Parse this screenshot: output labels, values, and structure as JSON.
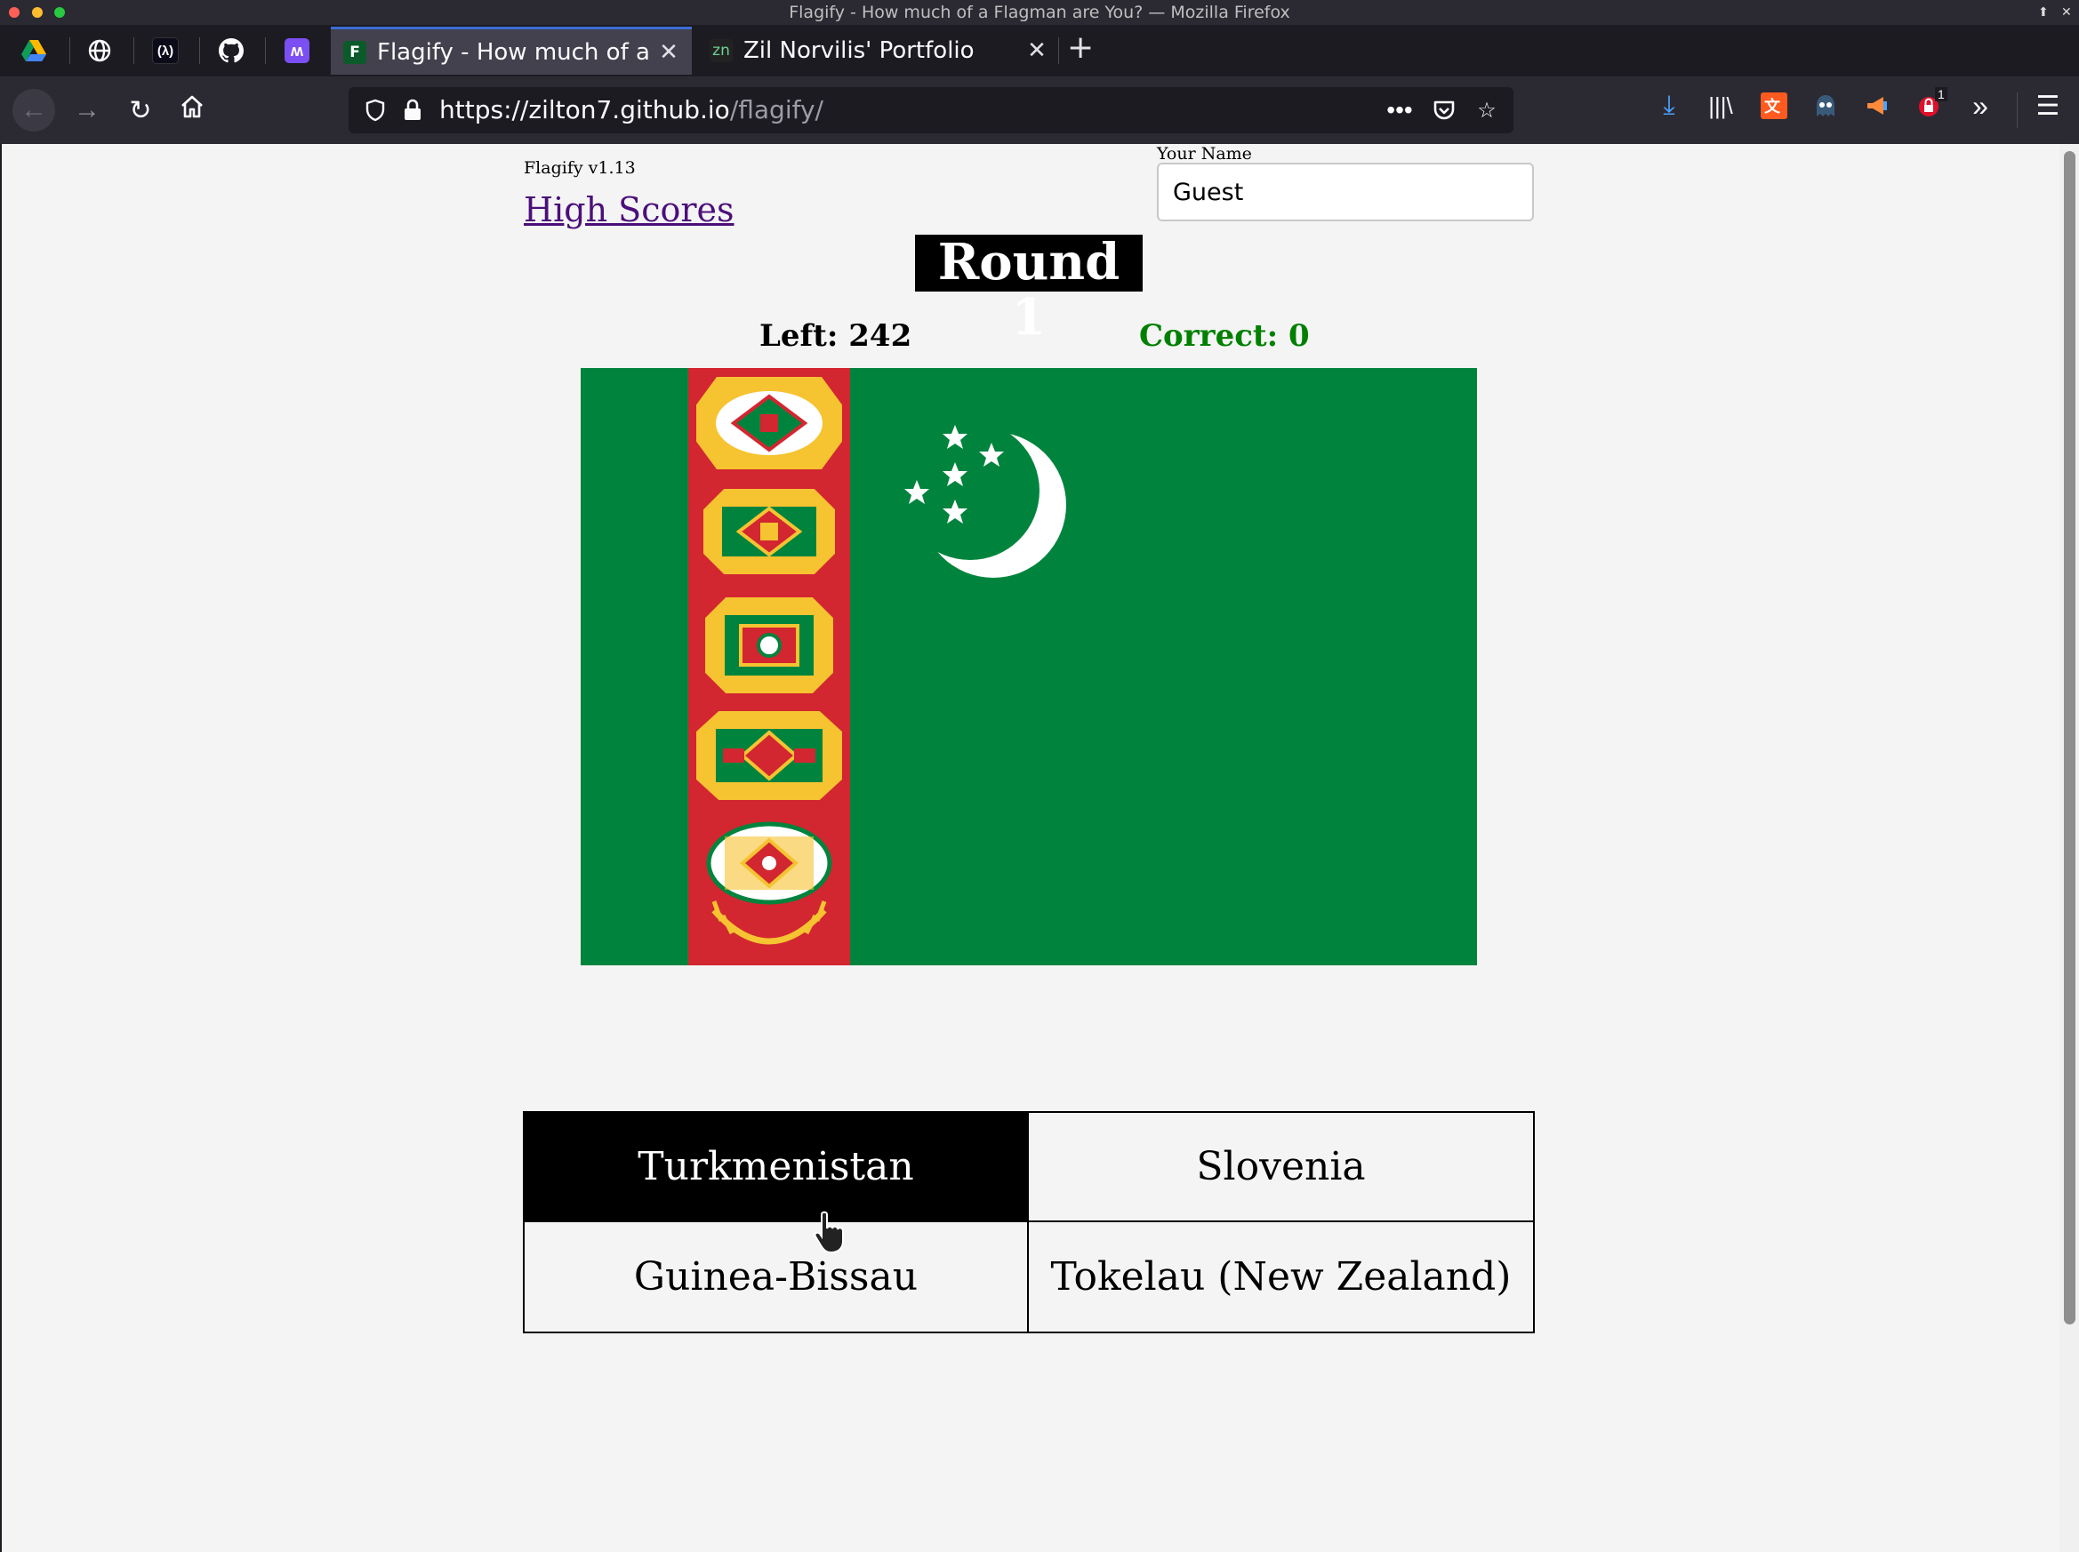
{
  "window": {
    "title": "Flagify - How much of a Flagman are You? — Mozilla Firefox"
  },
  "tabs": [
    {
      "label": "Flagify - How much of a Flagman are You?",
      "favicon": "F",
      "active": true
    },
    {
      "label": "Zil Norvilis' Portfolio",
      "favicon": "zn",
      "active": false
    }
  ],
  "pinned_tabs": [
    "google-drive-icon",
    "globe-icon",
    "lambda-icon",
    "github-icon",
    "m-app-icon"
  ],
  "address_bar": {
    "url_host": "https://zilton7.github.io",
    "url_path": "/flagify/"
  },
  "toolbar_badge": "1",
  "page": {
    "version": "Flagify v1.13",
    "high_scores_link": "High Scores",
    "name_label": "Your Name",
    "name_value": "Guest",
    "round_label": "Round 1",
    "left_label": "Left: 242",
    "correct_label": "Correct: 0",
    "answers": [
      "Turkmenistan",
      "Slovenia",
      "Guinea-Bissau",
      "Tokelau (New Zealand)"
    ],
    "selected_answer": "Turkmenistan"
  },
  "colors": {
    "flag_green": "#00843d",
    "flag_red": "#d22630",
    "correct_green": "#008000",
    "link_purple": "#4b0f7a"
  }
}
